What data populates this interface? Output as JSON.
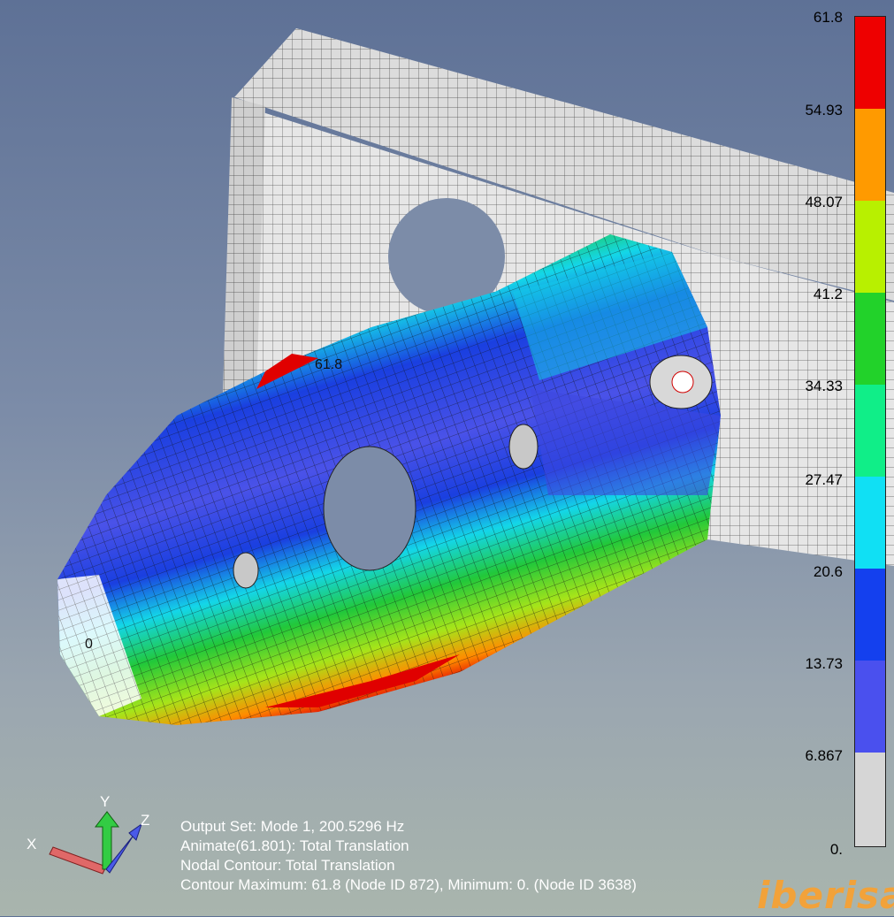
{
  "legend": {
    "labels": [
      "61.8",
      "54.93",
      "48.07",
      "41.2",
      "34.33",
      "27.47",
      "20.6",
      "13.73",
      "6.867",
      "0."
    ],
    "colors": [
      "#ee0000",
      "#ff9a00",
      "#b8f000",
      "#22d22a",
      "#10ee88",
      "#10e0f4",
      "#1440ee",
      "#4a50ee",
      "#d6d6d6"
    ]
  },
  "info": {
    "line1": "Output Set: Mode 1, 200.5296 Hz",
    "line2": "Animate(61.801): Total Translation",
    "line3": "Nodal Contour: Total Translation",
    "line4": "Contour Maximum: 61.8 (Node ID 872), Minimum: 0. (Node ID 3638)"
  },
  "triad": {
    "x": "X",
    "y": "Y",
    "z": "Z"
  },
  "markers": {
    "max": "61.8",
    "min": "0"
  },
  "brand": "iberisa"
}
